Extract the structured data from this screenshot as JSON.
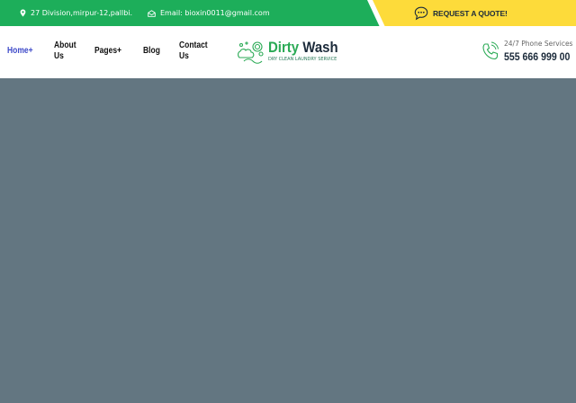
{
  "topbar": {
    "address": "27 Division,mirpur-12,pallbi.",
    "email": "Email: bioxin0011@gmail.com",
    "quote_label": "REQUEST A QUOTE!"
  },
  "nav": {
    "home": "Home+",
    "about": "About Us",
    "pages": "Pages+",
    "blog": "Blog",
    "contact": "Contact Us"
  },
  "logo": {
    "word1": "Dirty",
    "word2": "Wash",
    "tagline": "DRY CLEAN LAUNDRY SERVICE"
  },
  "phone": {
    "label": "24/7 Phone Services",
    "number": "555 666 999 00"
  },
  "colors": {
    "topbar_green": "#1dae5a",
    "quote_yellow": "#fddb3a",
    "nav_active": "#3f4bc9",
    "dark_text": "#1b2a3a",
    "hero_bg": "#637681"
  },
  "icons": [
    "map-pin-icon",
    "envelope-icon",
    "chat-bubble-icon",
    "laundry-logo-icon",
    "phone-icon"
  ]
}
